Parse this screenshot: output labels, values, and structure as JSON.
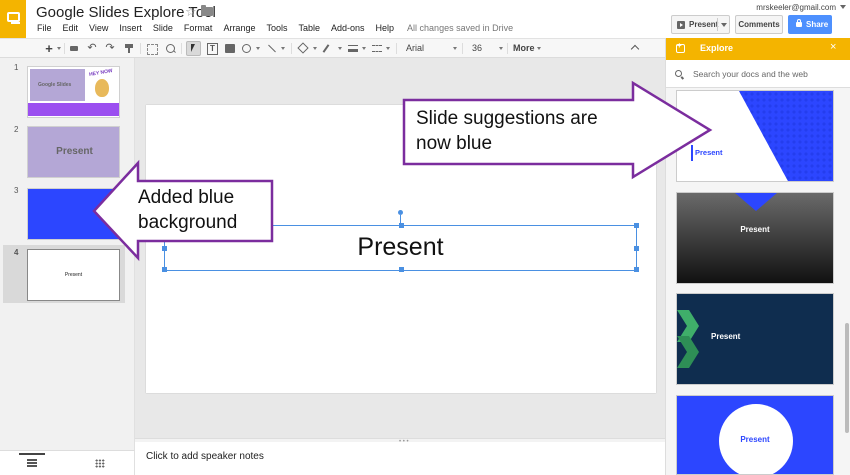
{
  "header": {
    "doc_title": "Google Slides Explore Tool",
    "menu": [
      "File",
      "Edit",
      "View",
      "Insert",
      "Slide",
      "Format",
      "Arrange",
      "Tools",
      "Table",
      "Add-ons",
      "Help"
    ],
    "save_status": "All changes saved in Drive",
    "account_email": "mrskeeler@gmail.com",
    "present_label": "Present",
    "comments_label": "Comments",
    "share_label": "Share",
    "brand_color": "#f4b400",
    "share_color": "#4d90fe"
  },
  "toolbar": {
    "new_slide_label": "+",
    "font_family": "Arial",
    "font_size": "36",
    "more_label": "More"
  },
  "filmstrip": {
    "slides": [
      {
        "number": "1",
        "title": "Google Slides",
        "sticker_text": "HEY NOW"
      },
      {
        "number": "2",
        "title": "Present"
      },
      {
        "number": "3",
        "title": ""
      },
      {
        "number": "4",
        "title": "Present"
      }
    ],
    "selected_slide": 4,
    "slide_colors": {
      "slide2": "#b4a7d6",
      "slide3": "#2c46ff"
    }
  },
  "slide": {
    "title": "Present",
    "selection_color": "#4a90e2"
  },
  "notes": {
    "placeholder": "Click to add speaker notes"
  },
  "explore": {
    "title": "Explore",
    "close_icon": "×",
    "search_placeholder": "Search your docs and the web",
    "suggestions": [
      {
        "label": "Present",
        "style": "blue-triangle"
      },
      {
        "label": "Present",
        "style": "dark-gradient"
      },
      {
        "label": "Present",
        "style": "navy-green"
      },
      {
        "label": "Present",
        "style": "blue-circle"
      }
    ],
    "accent_color": "#2c46ff"
  },
  "annotations": {
    "right_callout": [
      "Slide suggestions are",
      "now blue"
    ],
    "left_callout": [
      "Added blue",
      "background"
    ],
    "callout_border_color": "#7b2d9e"
  }
}
